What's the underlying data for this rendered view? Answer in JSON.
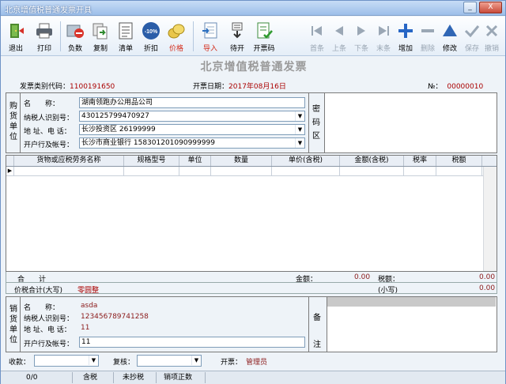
{
  "window": {
    "title": "北京增值税普通发票开具",
    "minimize": "_",
    "close": "X"
  },
  "toolbar": {
    "buttons": [
      {
        "label": "退出",
        "icon": "exit-door-icon"
      },
      {
        "label": "打印",
        "icon": "printer-icon"
      },
      {
        "label": "负数",
        "icon": "negative-invoice-icon"
      },
      {
        "label": "复制",
        "icon": "copy-icon"
      },
      {
        "label": "清单",
        "icon": "list-icon"
      },
      {
        "label": "折扣",
        "icon": "discount-icon",
        "badge": "-10%"
      },
      {
        "label": "价格",
        "icon": "coins-icon"
      },
      {
        "label": "导入",
        "icon": "import-icon"
      },
      {
        "label": "待开",
        "icon": "pending-icon"
      },
      {
        "label": "开票码",
        "icon": "invoice-code-icon"
      }
    ],
    "nav": [
      {
        "label": "首条",
        "icon": "first-record-icon"
      },
      {
        "label": "上条",
        "icon": "prev-record-icon"
      },
      {
        "label": "下条",
        "icon": "next-record-icon"
      },
      {
        "label": "末条",
        "icon": "last-record-icon"
      },
      {
        "label": "增加",
        "icon": "add-icon"
      },
      {
        "label": "删除",
        "icon": "delete-icon"
      },
      {
        "label": "修改",
        "icon": "edit-icon"
      },
      {
        "label": "保存",
        "icon": "save-check-icon"
      },
      {
        "label": "撤销",
        "icon": "undo-icon"
      }
    ]
  },
  "invoice": {
    "title": "北京增值税普通发票",
    "type_code_label": "发票类别代码：",
    "type_code": "1100191650",
    "date_label": "开票日期：",
    "date": "2017年08月16日",
    "no_label": "№：",
    "no": "00000010"
  },
  "buyer": {
    "section_label": "购货单位",
    "name_label": "名　　称：",
    "name": "湖南领跑办公用品公司",
    "tax_id_label": "纳税人识别号：",
    "tax_id": "430125799470927",
    "addr_label": "地 址、电 话：",
    "addr": "长沙投资区 26199999",
    "bank_label": "开户行及帐号：",
    "bank": "长沙市商业银行 158301201090999999",
    "password_label": "密码区"
  },
  "items": {
    "columns": [
      "货物或应税劳务名称",
      "规格型号",
      "单位",
      "数量",
      "单价(含税)",
      "金额(含税)",
      "税率",
      "税额"
    ]
  },
  "totals": {
    "sum_label": "合　　计",
    "amount_label": "金额：",
    "amount": "0.00",
    "tax_label": "税额：",
    "tax": "0.00",
    "total_caps_label": "价税合计(大写)",
    "total_caps": "零圆整",
    "small_label": "(小写)",
    "small": "0.00"
  },
  "seller": {
    "section_label": "销货单位",
    "name_label": "名　　称：",
    "name": "asda",
    "tax_id_label": "纳税人识别号：",
    "tax_id": "123456789741258",
    "addr_label": "地 址、电 话：",
    "addr": "11",
    "bank_label": "开户行及帐号：",
    "bank": "11",
    "remark_label": "备注"
  },
  "footer": {
    "payee_label": "收款：",
    "reviewer_label": "复核：",
    "drawer_label": "开票：",
    "drawer": "管理员"
  },
  "status": {
    "count": "0/0",
    "tax_incl": "含税",
    "not_copied": "未抄税",
    "sales_normal": "销项正数"
  }
}
